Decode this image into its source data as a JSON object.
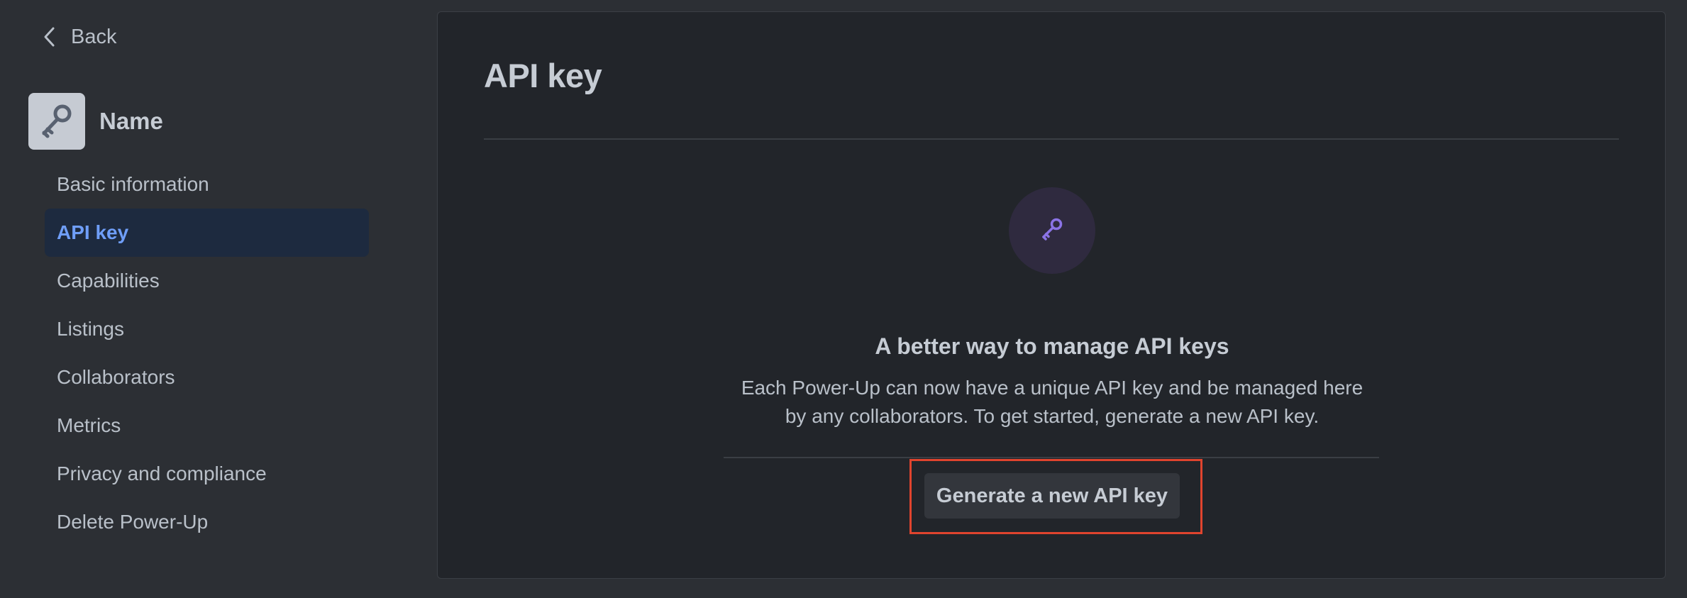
{
  "nav": {
    "back_label": "Back",
    "back_icon": "chevron-left-icon"
  },
  "app": {
    "name": "Name",
    "avatar_icon": "key-icon"
  },
  "sidebar": {
    "items": [
      {
        "label": "Basic information",
        "active": false
      },
      {
        "label": "API key",
        "active": true
      },
      {
        "label": "Capabilities",
        "active": false
      },
      {
        "label": "Listings",
        "active": false
      },
      {
        "label": "Collaborators",
        "active": false
      },
      {
        "label": "Metrics",
        "active": false
      },
      {
        "label": "Privacy and compliance",
        "active": false
      },
      {
        "label": "Delete Power-Up",
        "active": false
      }
    ]
  },
  "main": {
    "title": "API key",
    "empty_state": {
      "icon": "key-icon",
      "heading": "A better way to manage API keys",
      "text_line1": "Each Power-Up can now have a unique API key and be managed here",
      "text_line2": "by any collaborators. To get started, generate a new API key.",
      "button_label": "Generate a new API key"
    }
  },
  "colors": {
    "background": "#2c2f34",
    "panel": "#22252a",
    "active_bg": "#1d2a3f",
    "active_text": "#6f9ef8",
    "key_accent": "#8b73e6",
    "highlight": "#e0442e"
  }
}
